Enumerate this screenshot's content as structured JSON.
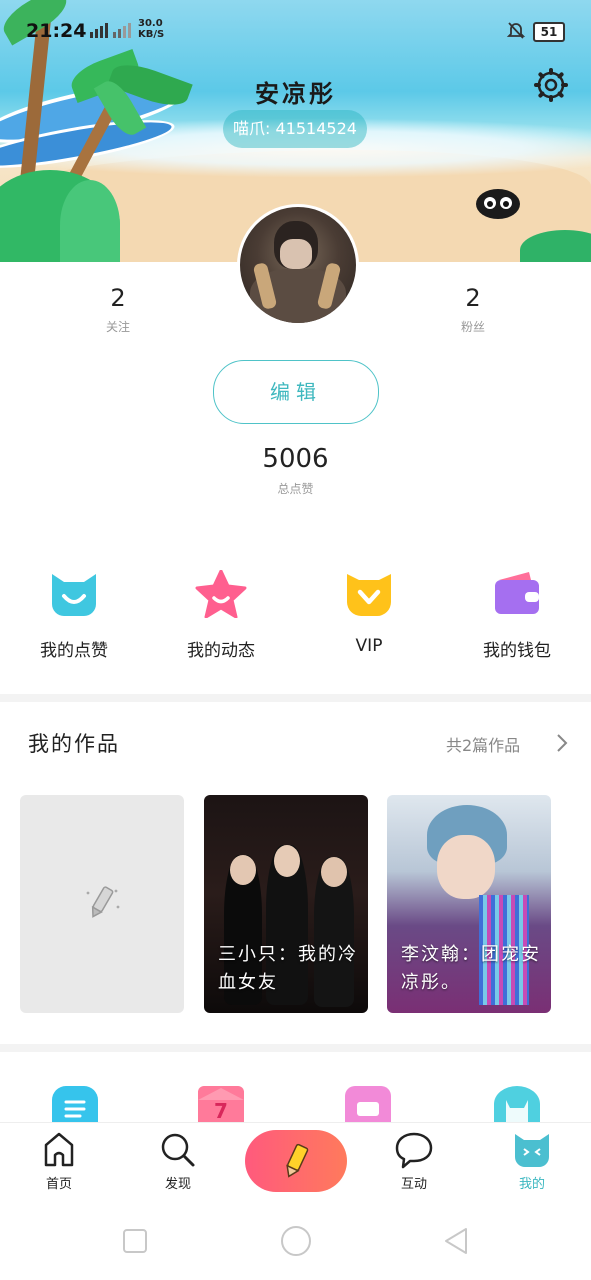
{
  "status_bar": {
    "time": "21:24",
    "signal": "⸬¹ᴴᵀ .ıl ˣ.ıl",
    "speed_value": "30.0",
    "speed_unit": "KB/S",
    "battery": "51"
  },
  "profile": {
    "username": "安凉彤",
    "id_text": "喵爪: 41514524"
  },
  "stats": {
    "following_count": "2",
    "following_label": "关注",
    "fans_count": "2",
    "fans_label": "粉丝"
  },
  "edit_label": "编辑",
  "total_likes": {
    "value": "5006",
    "label": "总点赞"
  },
  "quick_actions": [
    {
      "label": "我的点赞",
      "icon": "cat-face-icon",
      "color": "#3fc7e0"
    },
    {
      "label": "我的动态",
      "icon": "star-icon",
      "color": "#ff5f8f"
    },
    {
      "label": "VIP",
      "icon": "vip-badge-icon",
      "color": "#ffc21a"
    },
    {
      "label": "我的钱包",
      "icon": "wallet-icon",
      "color": "#a56ff0"
    }
  ],
  "works": {
    "title": "我的作品",
    "count_text": "共2篇作品",
    "items": [
      {
        "title": "",
        "type": "new"
      },
      {
        "title": "三小只：我的冷血女友",
        "type": "cover"
      },
      {
        "title": "李汶翰：团宠安凉彤。",
        "type": "cover"
      }
    ]
  },
  "tabs": [
    {
      "label": "首页",
      "icon": "home-icon"
    },
    {
      "label": "发现",
      "icon": "search-icon"
    },
    {
      "label": "互动",
      "icon": "chat-bubble-icon"
    },
    {
      "label": "我的",
      "icon": "cat-face-icon"
    }
  ],
  "colors": {
    "accent": "#3bb7c0",
    "fab": "#ff6a6a"
  }
}
